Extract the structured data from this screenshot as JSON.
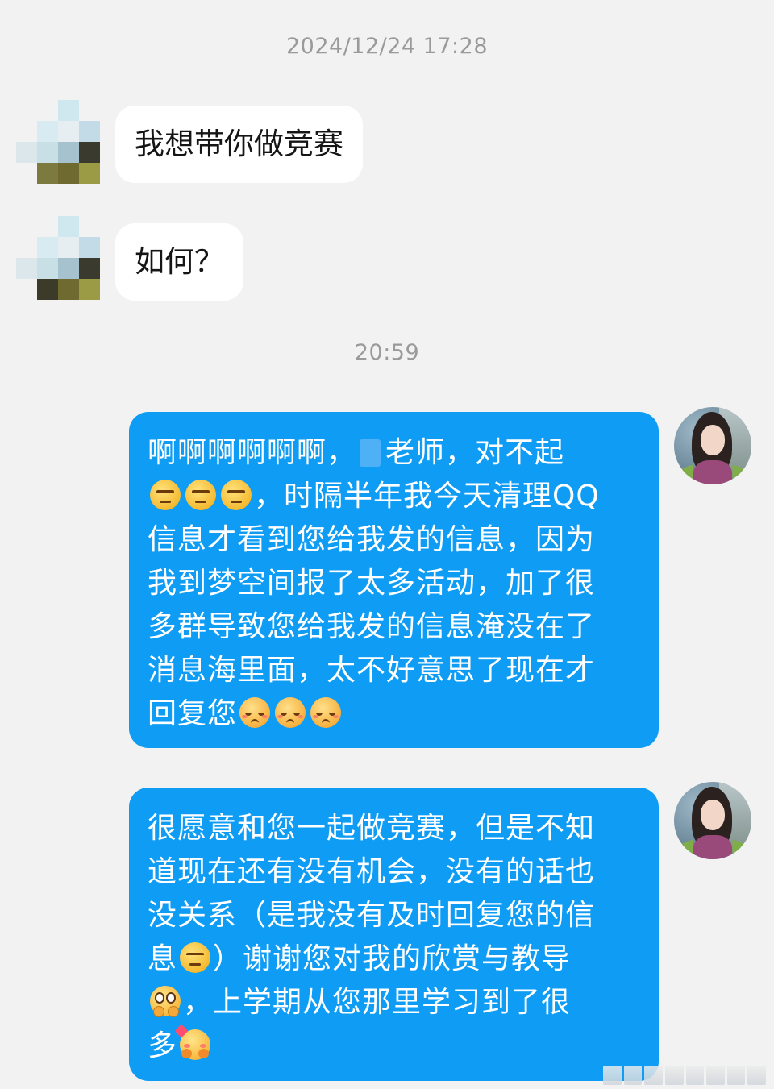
{
  "timestamps": {
    "first": "2024/12/24 17:28",
    "second": "20:59"
  },
  "messages": [
    {
      "side": "left",
      "avatar": "pixelated-avatar",
      "text": "我想带你做竞赛"
    },
    {
      "side": "left",
      "avatar": "pixelated-avatar",
      "text": "如何？"
    }
  ],
  "reply1": {
    "line1a": "啊啊啊啊啊啊，",
    "line1b": "老师，对不起",
    "line2": "，时隔半年我今天清理QQ",
    "line3": "信息才看到您给我发的信息，因为",
    "line4": "我到梦空间报了太多活动，加了很",
    "line5": "多群导致您给我发的信息淹没在了",
    "line6": "消息海里面，太不好意思了现在才",
    "line7": "回复您",
    "emojis": [
      "smirk-emoji",
      "smirk-emoji",
      "smirk-emoji",
      "pensive-emoji",
      "pensive-emoji",
      "pensive-emoji"
    ]
  },
  "reply2": {
    "line1": "很愿意和您一起做竞赛，但是不知",
    "line2": "道现在还有没有机会，没有的话也",
    "line3": "没关系（是我没有及时回复您的信",
    "line4a": "息",
    "line4b": "）谢谢您对我的欣赏与教导",
    "line5": "，上学期从您那里学习到了很",
    "line6": "多",
    "emojis": [
      "smirk-emoji",
      "hopeful-emoji",
      "hug-emoji"
    ]
  },
  "colors": {
    "background": "#f2f2f2",
    "outgoing_bubble": "#0f9cf5",
    "incoming_bubble": "#ffffff",
    "timestamp": "#9a9a9a"
  },
  "icons": {
    "left_avatar": "pixelated-avatar",
    "right_avatar": "girl-photo-avatar"
  }
}
